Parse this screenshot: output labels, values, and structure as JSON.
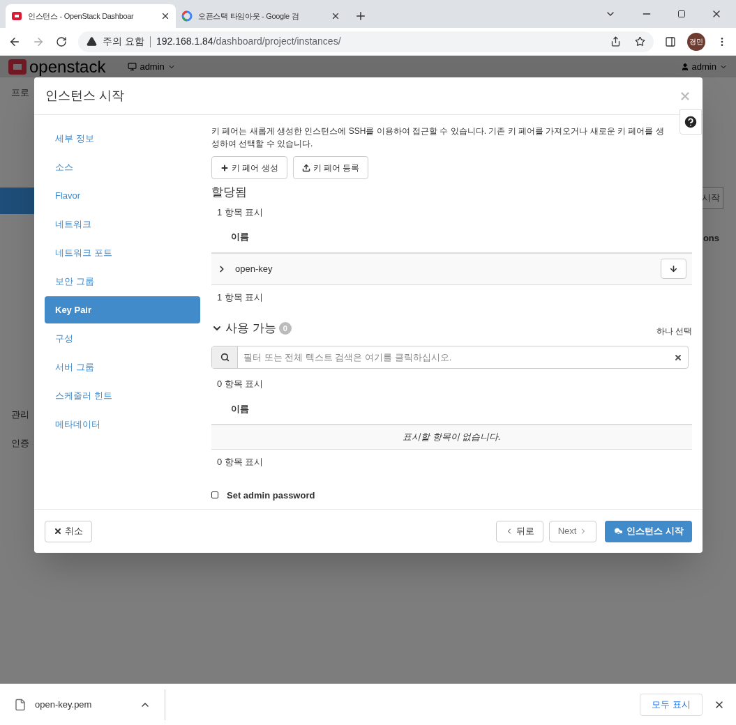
{
  "browser": {
    "tabs": [
      {
        "title": "인스턴스 - OpenStack Dashboar",
        "selected": true,
        "kind": "openstack"
      },
      {
        "title": "오픈스택 타임아웃 - Google 검",
        "selected": false,
        "kind": "google"
      }
    ],
    "address": {
      "warning": "주의 요함",
      "host": "192.168.1.84",
      "path": "/dashboard/project/instances/"
    },
    "profile": "경민"
  },
  "page": {
    "logo": "openstack",
    "project": "admin",
    "user": "admin",
    "left_texts": [
      "프로",
      "관리",
      "인증"
    ],
    "right_button": "시작",
    "right_heading": "ons"
  },
  "modal": {
    "title": "인스턴스 시작",
    "nav": [
      {
        "label": "세부 정보",
        "selected": false
      },
      {
        "label": "소스",
        "selected": false
      },
      {
        "label": "Flavor",
        "selected": false
      },
      {
        "label": "네트워크",
        "selected": false
      },
      {
        "label": "네트워크 포트",
        "selected": false
      },
      {
        "label": "보안 그룹",
        "selected": false
      },
      {
        "label": "Key Pair",
        "selected": true
      },
      {
        "label": "구성",
        "selected": false
      },
      {
        "label": "서버 그룹",
        "selected": false
      },
      {
        "label": "스케줄러 힌트",
        "selected": false
      },
      {
        "label": "메타데이터",
        "selected": false
      }
    ],
    "description": "키 페어는 새롭게 생성한 인스턴스에 SSH를 이용하여 접근할 수 있습니다. 기존 키 페어를 가져오거나 새로운 키 페어를 생성하여 선택할 수 있습니다.",
    "buttons": [
      {
        "label": "키 페어 생성",
        "kind": "create"
      },
      {
        "label": "키 페어 등록",
        "kind": "import"
      }
    ],
    "allocated": {
      "title": "할당됨",
      "count_top": "1 항목 표시",
      "column": "이름",
      "rows": [
        {
          "name": "open-key",
          "expanded": false
        }
      ],
      "count_bottom": "1 항목 표시"
    },
    "available": {
      "title": "사용 가능",
      "expanded": true,
      "badge": "0",
      "hint": "하나 선택",
      "placeholder": "필터 또는 전체 텍스트 검색은 여기를 클릭하십시오.",
      "count_top": "0 항목 표시",
      "column": "이름",
      "empty": "표시할 항목이 없습니다.",
      "count_bottom": "0 항목 표시"
    },
    "admin_password": {
      "label": "Set admin password",
      "checked": false
    },
    "footer": {
      "cancel": "취소",
      "back": "뒤로",
      "next": "Next",
      "launch": "인스턴스 시작"
    }
  },
  "downloads": {
    "file": "open-key.pem",
    "show_all": "모두 표시"
  }
}
